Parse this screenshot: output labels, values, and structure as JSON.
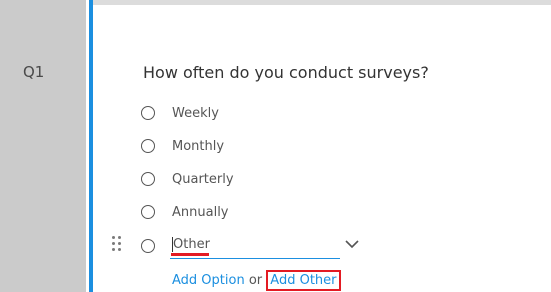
{
  "question": {
    "number": "Q1",
    "text": "How often do you conduct surveys?",
    "options": [
      "Weekly",
      "Monthly",
      "Quarterly",
      "Annually"
    ],
    "other_value": "Other"
  },
  "actions": {
    "add_option": "Add Option",
    "separator": "or",
    "add_other": "Add Other"
  },
  "colors": {
    "accent": "#1b8fe0",
    "highlight": "#e31b23",
    "gutter": "#cbcbcb"
  },
  "icons": [
    "drag-handle-icon",
    "chevron-down-icon",
    "radio-icon"
  ]
}
